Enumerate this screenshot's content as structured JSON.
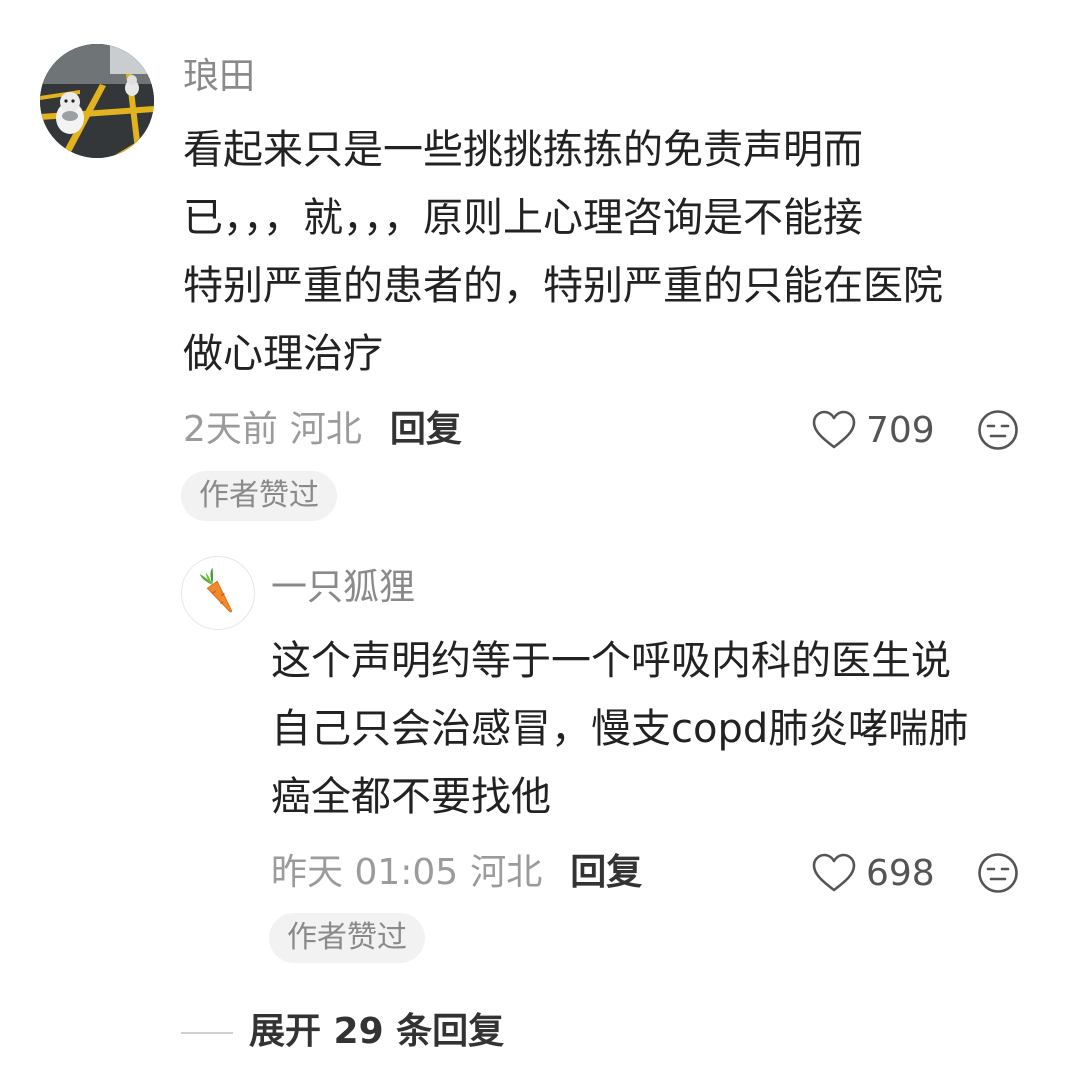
{
  "comment": {
    "username": "琅田",
    "text": "看起来只是一些挑挑拣拣的免责声明而\n已，，，就，，，原则上心理咨询是不能接\n特别严重的患者的，特别严重的只能在医院\n做心理治疗",
    "time": "2天前",
    "location": "河北",
    "reply_label": "回复",
    "likes": "709",
    "badge": "作者赞过",
    "avatar_icon": "road-cat-photo",
    "like_icon": "heart-outline-icon",
    "dislike_icon": "meh-face-icon"
  },
  "reply": {
    "username": "一只狐狸",
    "text": "这个声明约等于一个呼吸内科的医生说\n自己只会治感冒，慢支copd肺炎哮喘肺\n癌全都不要找他",
    "time": "昨天 01:05",
    "location": "河北",
    "reply_label": "回复",
    "likes": "698",
    "badge": "作者赞过",
    "avatar_icon": "carrot-icon"
  },
  "expand_label": "展开 29 条回复",
  "colors": {
    "text": "#222222",
    "muted": "#9b9b9b",
    "badge_bg": "#f2f2f2",
    "carrot": "#f08a2c"
  }
}
